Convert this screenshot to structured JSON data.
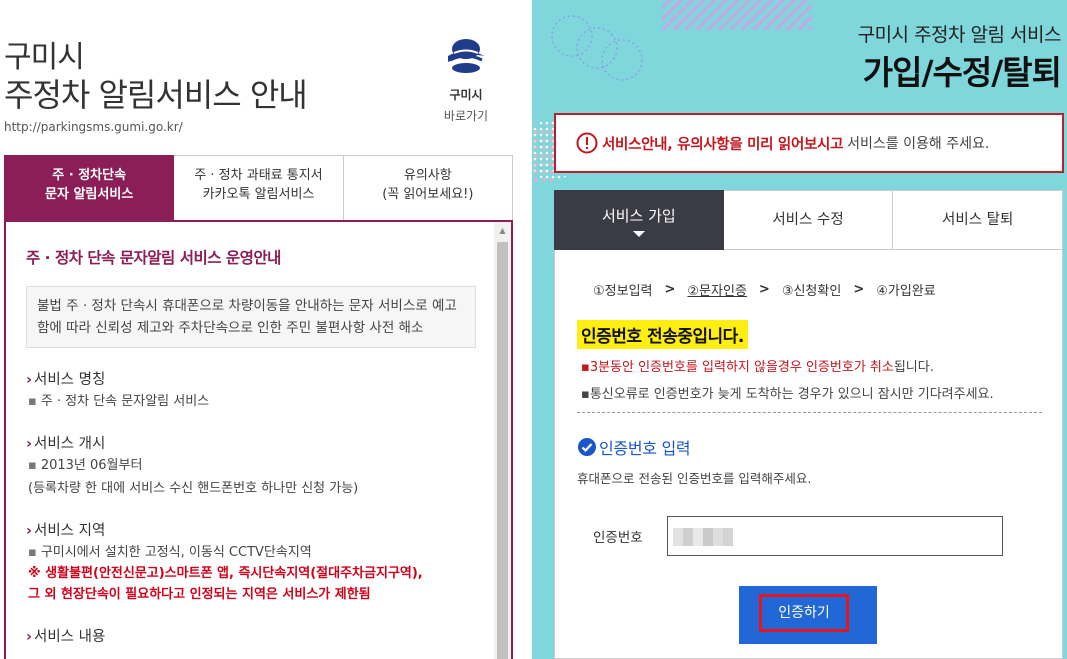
{
  "left": {
    "title_line1": "구미시",
    "title_line2": "주정차 알림서비스 안내",
    "url": "http://parkingsms.gumi.go.kr/",
    "logo": {
      "icon": "gumi-city-logo-icon",
      "city": "구미시",
      "goto": "바로가기"
    },
    "tabs": [
      {
        "line1": "주 · 정차단속",
        "line2": "문자 알림서비스",
        "active": true
      },
      {
        "line1": "주 · 정차 과태료 통지서",
        "line2": "카카오톡 알림서비스",
        "active": false
      },
      {
        "line1": "유의사항",
        "line2": "(꼭 읽어보세요!)",
        "active": false
      }
    ],
    "content": {
      "heading": "주 · 정차 단속 문자알림 서비스 운영안내",
      "intro": "불법 주 · 정차 단속시 휴대폰으로 차량이동을 안내하는 문자 서비스로 예고함에 따라 신뢰성 제고와 주차단속으로 인한 주민 불편사항 사전 해소",
      "sections": [
        {
          "title": "서비스 명칭",
          "lines": [
            "주 · 정차 단속 문자알림 서비스"
          ]
        },
        {
          "title": "서비스 개시",
          "lines": [
            "2013년 06월부터"
          ],
          "extra": "(등록차량 한 대에 서비스 수신 핸드폰번호 하나만 신청 가능)"
        },
        {
          "title": "서비스 지역",
          "lines": [
            "구미시에서 설치한 고정식, 이동식 CCTV단속지역"
          ],
          "notes": [
            "※ 생활불편(안전신문고)스마트폰 앱, 즉시단속지역(절대주차금지구역),",
            "그 외 현장단속이 필요하다고 인정되는 지역은 서비스가 제한됨"
          ]
        },
        {
          "title": "서비스 내용",
          "lines": []
        }
      ]
    }
  },
  "right": {
    "subtitle": "구미시 주정차 알림 서비스",
    "title": "가입/수정/탈퇴",
    "notice": {
      "strong": "서비스안내, 유의사항을 미리 읽어보시고",
      "rest": "서비스를 이용해 주세요."
    },
    "tabs": [
      {
        "label": "서비스 가입",
        "active": true
      },
      {
        "label": "서비스 수정",
        "active": false
      },
      {
        "label": "서비스 탈퇴",
        "active": false
      }
    ],
    "steps": [
      {
        "label": "①정보입력",
        "current": false
      },
      {
        "label": "②문자인증",
        "current": true
      },
      {
        "label": "③신청확인",
        "current": false
      },
      {
        "label": "④가입완료",
        "current": false
      }
    ],
    "step_arrow": ">",
    "sending": "인증번호 전송중입니다.",
    "warn1_a": "3분동안 인증번호를 입력하지 않을경우 인증번호가 취소",
    "warn1_b": "됩니다.",
    "warn2": "통신오류로 인증번호가 늦게 도착하는 경우가 있으니 잠시만 기다려주세요.",
    "auth_heading": "인증번호 입력",
    "auth_desc": "휴대폰으로 전송된 인증번호를 입력해주세요.",
    "code_label": "인증번호",
    "code_value": "",
    "submit_label": "인증하기",
    "colors": {
      "accent": "#8b1e56",
      "bg": "#7fd6db",
      "button": "#2267d6",
      "highlight": "#ffee11",
      "alert": "#c4161c"
    }
  }
}
